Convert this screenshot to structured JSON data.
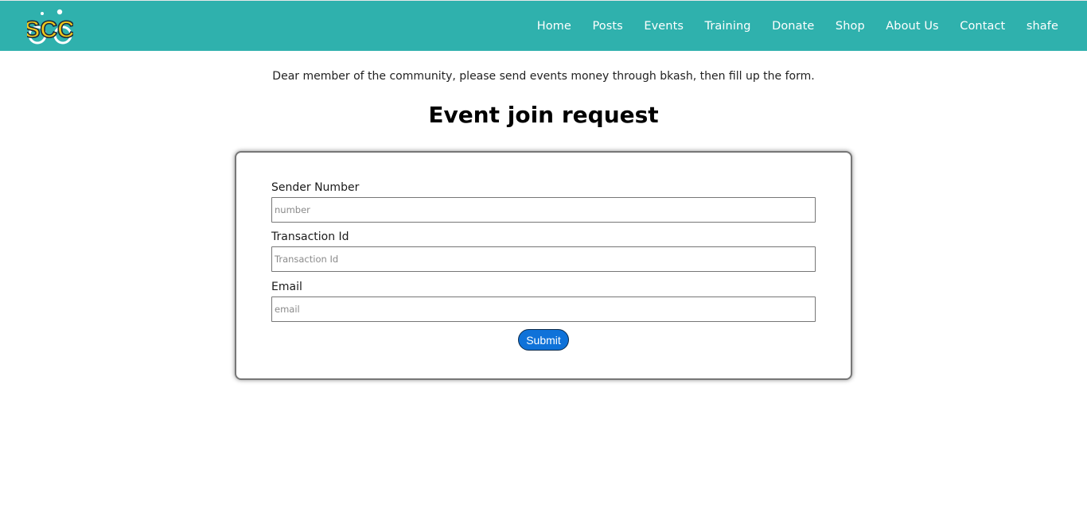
{
  "brand": {
    "logo_text": "SCC",
    "logo_icon": "scc-logo-icon",
    "colors": {
      "nav_bg": "#2fb1ad",
      "logo_yellow": "#f2c81b",
      "logo_dark": "#1b2a3a",
      "submit_bg": "#0f72d9"
    }
  },
  "nav": {
    "items": [
      {
        "label": "Home"
      },
      {
        "label": "Posts"
      },
      {
        "label": "Events"
      },
      {
        "label": "Training"
      },
      {
        "label": "Donate"
      },
      {
        "label": "Shop"
      },
      {
        "label": "About Us"
      },
      {
        "label": "Contact"
      },
      {
        "label": "shafe"
      }
    ]
  },
  "notice": "Dear member of the community, please send events money through bkash, then fill up the form.",
  "form": {
    "title": "Event join request",
    "fields": [
      {
        "label": "Sender Number",
        "placeholder": "number",
        "value": ""
      },
      {
        "label": "Transaction Id",
        "placeholder": "Transaction Id",
        "value": ""
      },
      {
        "label": "Email",
        "placeholder": "email",
        "value": ""
      }
    ],
    "submit_label": "Submit"
  }
}
